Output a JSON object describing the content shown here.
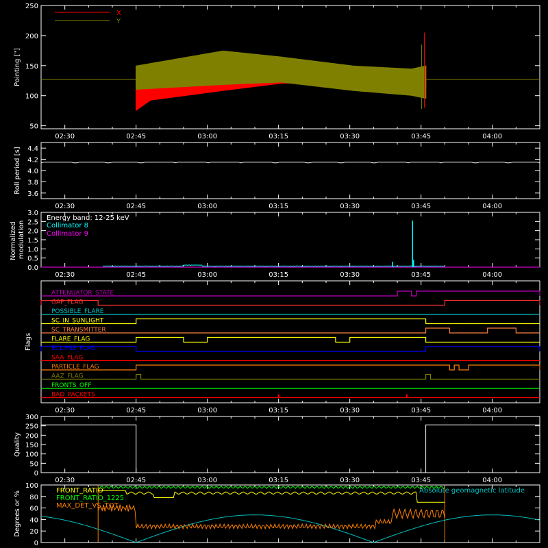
{
  "chart_data": [
    {
      "type": "line",
      "id": "pointing",
      "ylabel": "Pointing [\"]",
      "ylim": [
        45,
        250
      ],
      "yticks": [
        50,
        100,
        150,
        200,
        250
      ],
      "xlim": [
        "02:25",
        "04:10"
      ],
      "xticks": [
        "02:30",
        "02:45",
        "03:00",
        "03:15",
        "03:30",
        "03:45",
        "04:00"
      ],
      "legend": "top-left",
      "reference_line": 127,
      "data_span": [
        "02:45",
        "03:46"
      ],
      "series": [
        {
          "name": "X",
          "color": "#ff0000",
          "lower": [
            [
              0,
              75
            ],
            [
              0.05,
              92
            ],
            [
              0.3,
              108
            ],
            [
              0.5,
              120
            ],
            [
              0.75,
              122
            ],
            [
              0.95,
              118
            ],
            [
              1,
              112
            ]
          ],
          "upper": [
            [
              0,
              145
            ],
            [
              0.05,
              142
            ],
            [
              0.3,
              138
            ],
            [
              0.5,
              132
            ],
            [
              0.75,
              128
            ],
            [
              0.95,
              138
            ],
            [
              1,
              150
            ]
          ]
        },
        {
          "name": "Y",
          "color": "#808000",
          "lower": [
            [
              0,
              110
            ],
            [
              0.3,
              118
            ],
            [
              0.5,
              122
            ],
            [
              0.75,
              108
            ],
            [
              0.95,
              100
            ],
            [
              1,
              95
            ]
          ],
          "upper": [
            [
              0,
              150
            ],
            [
              0.3,
              175
            ],
            [
              0.5,
              165
            ],
            [
              0.75,
              150
            ],
            [
              0.95,
              145
            ],
            [
              1,
              150
            ]
          ]
        }
      ]
    },
    {
      "type": "line",
      "id": "roll",
      "ylabel": "Roll period [s]",
      "ylim": [
        3.5,
        4.5
      ],
      "yticks": [
        "3.6",
        "3.8",
        "4.0",
        "4.2",
        "4.4"
      ],
      "xticks": [
        "02:30",
        "02:45",
        "03:00",
        "03:15",
        "03:30",
        "03:45",
        "04:00"
      ],
      "series": [
        {
          "name": "",
          "color": "#ffffff",
          "value": 4.15
        }
      ]
    },
    {
      "type": "line",
      "id": "modulation",
      "ylabel": "Normalized modulation",
      "ylim": [
        0,
        3.0
      ],
      "yticks": [
        "0.0",
        "0.5",
        "1.0",
        "1.5",
        "2.0",
        "2.5",
        "3.0"
      ],
      "xticks": [
        "02:30",
        "02:45",
        "03:00",
        "03:15",
        "03:30",
        "03:45",
        "04:00"
      ],
      "legend": "top-left",
      "energy_band": "Energy band: 12-25 keV",
      "series": [
        {
          "name": "Collimator 8",
          "color": "#00ffff",
          "span": [
            "02:38",
            "03:50"
          ],
          "baseline": 0.04,
          "spikes": [
            [
              "03:39",
              0.3
            ],
            [
              "03:43",
              2.55
            ],
            [
              "03:43",
              0.4
            ]
          ]
        },
        {
          "name": "Collimator 9",
          "color": "#ff00ff",
          "span": [
            "02:25",
            "04:10"
          ],
          "baseline": 0.0
        }
      ]
    },
    {
      "type": "line",
      "id": "flags",
      "ylabel": "Flags",
      "xticks": [
        "02:30",
        "02:45",
        "03:00",
        "03:15",
        "03:30",
        "03:45",
        "04:00"
      ],
      "flags": [
        {
          "name": "ATTENUATOR_STATE",
          "color": "#c000c0",
          "on": [
            [
              "03:40",
              "03:43"
            ],
            [
              "03:44",
              "04:10"
            ]
          ]
        },
        {
          "name": "GAP_FLAG",
          "color": "#ff3030",
          "on": [
            [
              "02:25",
              "02:37"
            ],
            [
              "03:50",
              "04:10"
            ]
          ]
        },
        {
          "name": "POSSIBLE_FLARE",
          "color": "#00c0c0",
          "on": []
        },
        {
          "name": "SC_IN_SUNLIGHT",
          "color": "#ffff00",
          "on": [
            [
              "02:45",
              "03:46"
            ]
          ]
        },
        {
          "name": "SC_TRANSMITTER",
          "color": "#ff8040",
          "on": [
            [
              "03:46",
              "03:51"
            ],
            [
              "03:59",
              "04:05"
            ]
          ]
        },
        {
          "name": "FLARE_FLAG",
          "color": "#ffff00",
          "on": [
            [
              "02:45",
              "02:55"
            ],
            [
              "03:00",
              "03:27"
            ],
            [
              "03:30",
              "03:46"
            ]
          ]
        },
        {
          "name": "ECLIPSE_FLAG",
          "color": "#0000ff",
          "on": [
            [
              "02:25",
              "02:45"
            ],
            [
              "03:46",
              "04:10"
            ]
          ]
        },
        {
          "name": "SAA_FLAG",
          "color": "#ff0000",
          "on": []
        },
        {
          "name": "PARTICLE_FLAG",
          "color": "#ff8000",
          "on": [
            [
              "02:45",
              "03:51"
            ],
            [
              "03:52",
              "03:53"
            ],
            [
              "03:55",
              "04:10"
            ]
          ]
        },
        {
          "name": "AAZ_FLAG",
          "color": "#808000",
          "on": [
            [
              "02:45",
              "02:46"
            ],
            [
              "03:46",
              "03:47"
            ]
          ]
        },
        {
          "name": "FRONTS_OFF",
          "color": "#00ff00",
          "on": []
        },
        {
          "name": "BAD_PACKETS",
          "color": "#ff0000",
          "on": [],
          "ticks": [
            "03:15",
            "03:42"
          ]
        }
      ]
    },
    {
      "type": "line",
      "id": "quality",
      "ylabel": "Quality",
      "ylim": [
        0,
        300
      ],
      "yticks": [
        0,
        50,
        100,
        150,
        200,
        250,
        300
      ],
      "xticks": [
        "02:30",
        "02:45",
        "03:00",
        "03:15",
        "03:30",
        "03:45",
        "04:00"
      ],
      "series": [
        {
          "name": "",
          "color": "#ffffff",
          "steps": [
            [
              "02:25",
              255
            ],
            [
              "02:45",
              0
            ],
            [
              "03:46",
              255
            ]
          ]
        }
      ]
    },
    {
      "type": "line",
      "id": "ratios",
      "ylabel": "Degrees or %",
      "ylim": [
        0,
        100
      ],
      "yticks": [
        0,
        20,
        40,
        60,
        80,
        100
      ],
      "legend": "top-left",
      "latitude_label": "Absolute geomagnetic latitude",
      "series": [
        {
          "name": "FRONT_RATIO",
          "color": "#ffff00"
        },
        {
          "name": "FRONT_RATIO_1225",
          "color": "#00ff00"
        },
        {
          "name": "MAX_DET_VS_TOT",
          "color": "#ff8000"
        },
        {
          "name": "",
          "color": "#00c0c0",
          "minima": [
            "02:45",
            "03:35"
          ],
          "max": 48
        }
      ]
    }
  ]
}
